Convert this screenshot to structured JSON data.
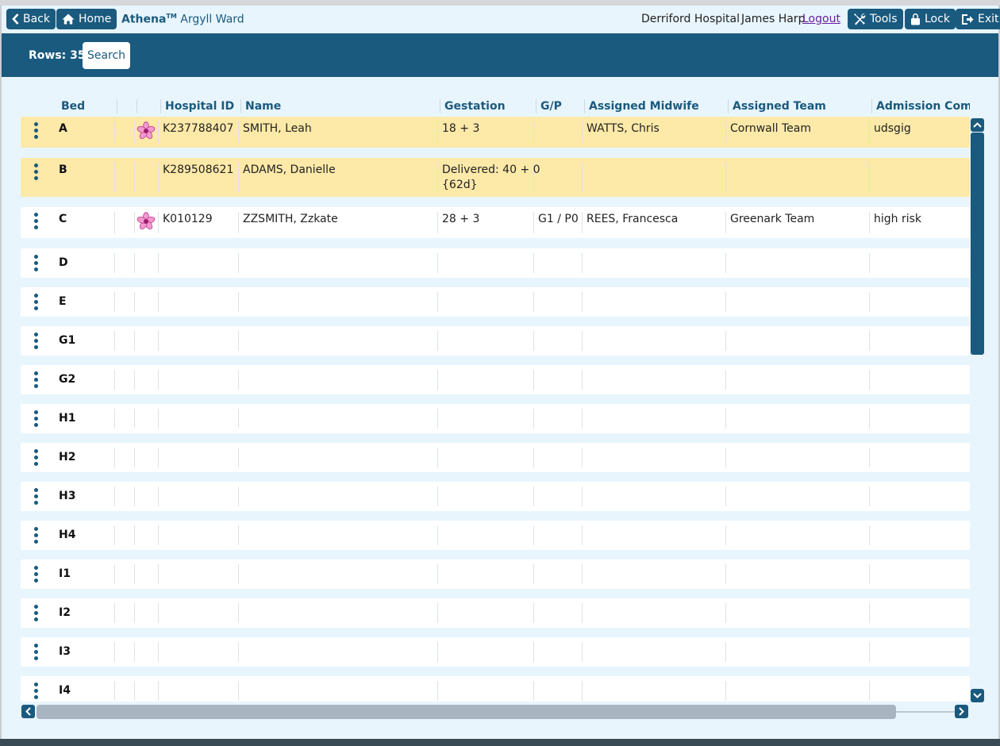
{
  "topbar": {
    "back_label": "Back",
    "home_label": "Home",
    "brand_name": "Athena",
    "brand_mark": "TM",
    "ward": "Argyll Ward",
    "hospital": "Derriford Hospital",
    "user": "James Harp",
    "logout_label": "Logout",
    "tools_label": "Tools",
    "lock_label": "Lock",
    "exit_label": "Exit"
  },
  "toolbar": {
    "rows_label": "Rows: 35",
    "search_label": "Search"
  },
  "table": {
    "headers": [
      "Bed",
      "Hospital ID",
      "Name",
      "Gestation",
      "G/P",
      "Assigned Midwife",
      "Assigned Team",
      "Admission Comm"
    ],
    "rows": [
      {
        "bed": "A",
        "flower": true,
        "highlight": true,
        "hospital_id": "K237788407",
        "name": "SMITH, Leah",
        "gestation": "18 + 3",
        "gp": "",
        "midwife": "WATTS, Chris",
        "team": "Cornwall Team",
        "comment": "udsgig"
      },
      {
        "bed": "B",
        "flower": false,
        "highlight": true,
        "hospital_id": "K289508621",
        "name": "ADAMS, Danielle",
        "gestation": "Delivered: 40 + 0",
        "gestation2": "{62d}",
        "gp": "",
        "midwife": "",
        "team": "",
        "comment": ""
      },
      {
        "bed": "C",
        "flower": true,
        "highlight": false,
        "hospital_id": "K010129",
        "name": "ZZSMITH, Zzkate",
        "gestation": "28 + 3",
        "gp": "G1 / P0",
        "midwife": "REES, Francesca",
        "team": "Greenark Team",
        "comment": "high risk"
      },
      {
        "bed": "D"
      },
      {
        "bed": "E"
      },
      {
        "bed": "G1"
      },
      {
        "bed": "G2"
      },
      {
        "bed": "H1"
      },
      {
        "bed": "H2"
      },
      {
        "bed": "H3"
      },
      {
        "bed": "H4"
      },
      {
        "bed": "I1"
      },
      {
        "bed": "I2"
      },
      {
        "bed": "I3"
      },
      {
        "bed": "I4"
      }
    ]
  },
  "colors": {
    "primary": "#1a5a7e",
    "highlight_row": "#fde9a8",
    "background": "#e8f5fd",
    "logout_link": "#6a1fa0"
  },
  "icons": [
    "chevron-left-icon",
    "home-icon",
    "tools-icon",
    "lock-icon",
    "exit-icon",
    "flower-icon",
    "more-vertical-icon"
  ]
}
